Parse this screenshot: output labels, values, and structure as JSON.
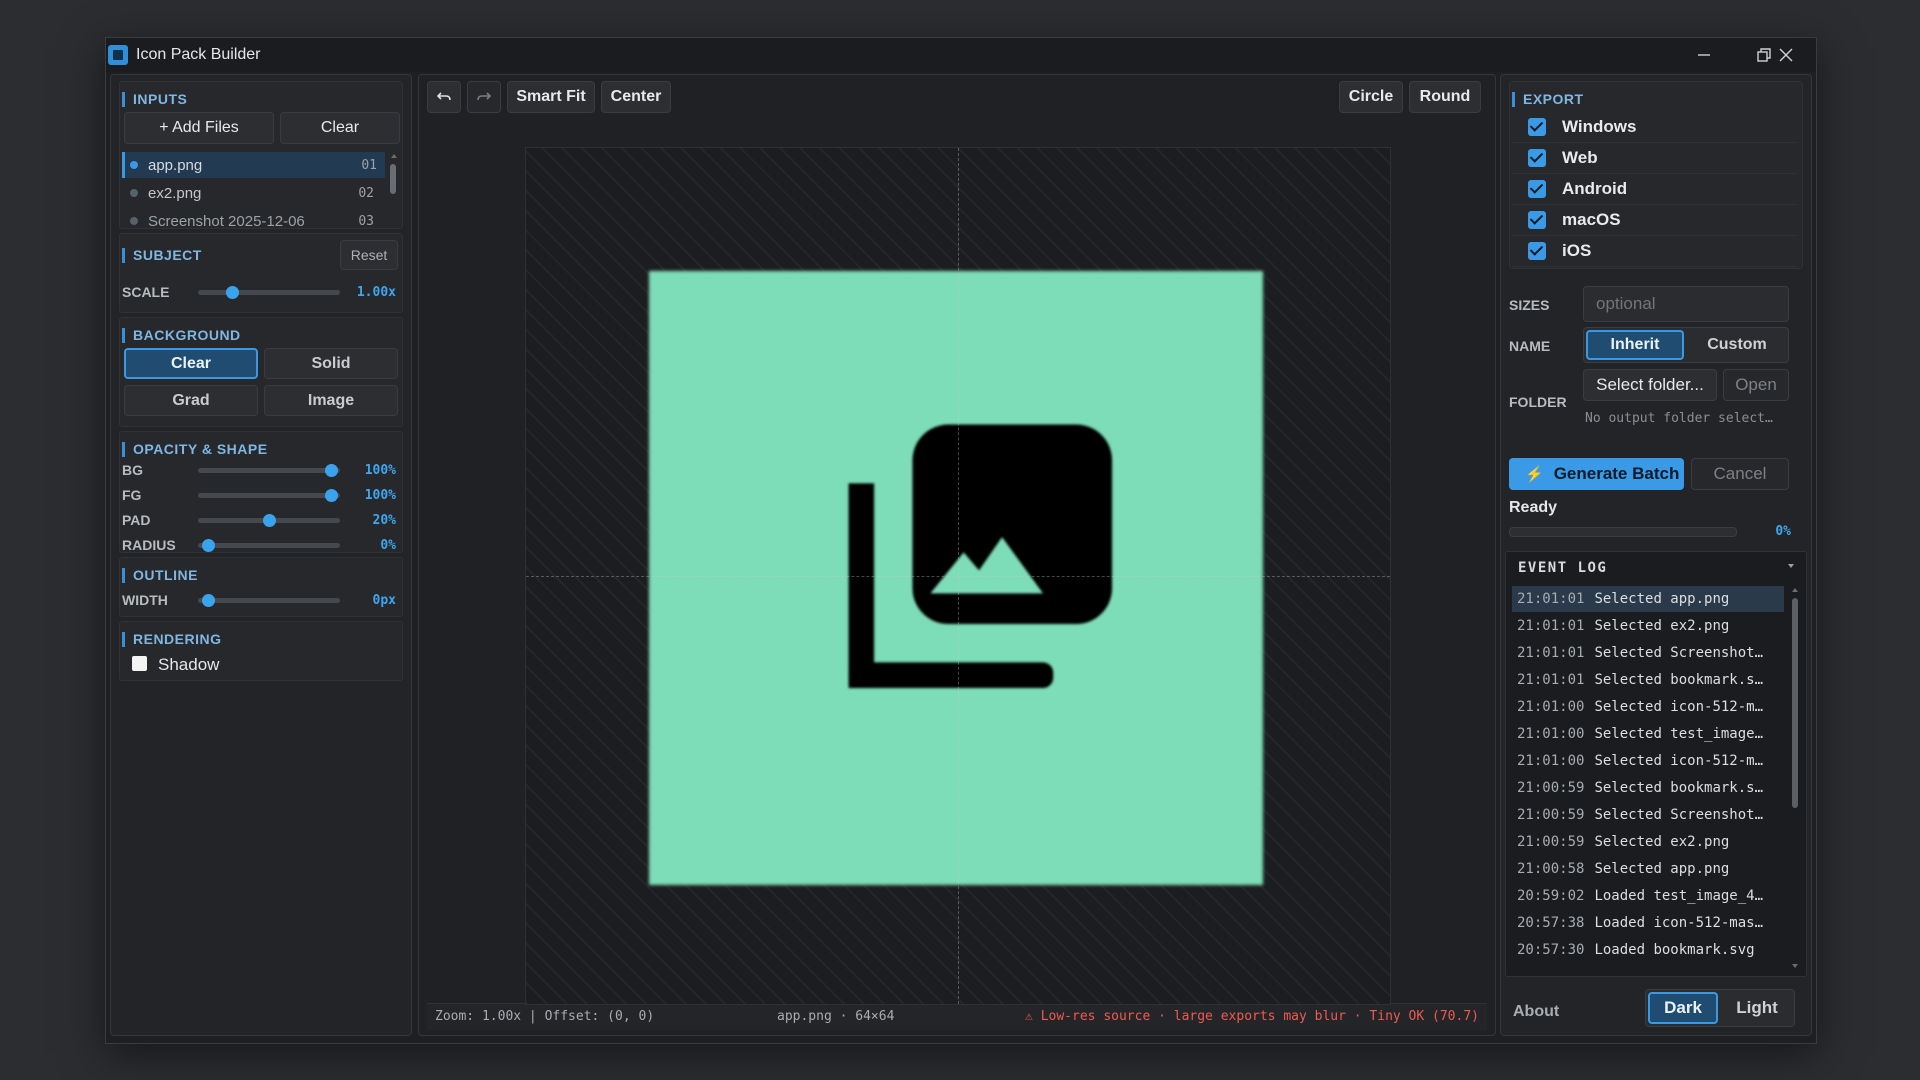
{
  "window": {
    "title": "Icon Pack Builder"
  },
  "inputs": {
    "title": "INPUTS",
    "add_label": "+ Add Files",
    "clear_label": "Clear",
    "files": [
      {
        "name": "app.png",
        "num": "01"
      },
      {
        "name": "ex2.png",
        "num": "02"
      },
      {
        "name": "Screenshot 2025-12-06",
        "num": "03"
      }
    ]
  },
  "subject": {
    "title": "SUBJECT",
    "reset_label": "Reset",
    "scale_label": "SCALE",
    "scale_value": "1.00x",
    "scale_fraction": 0.24
  },
  "background": {
    "title": "BACKGROUND",
    "options": [
      "Clear",
      "Solid",
      "Grad",
      "Image"
    ],
    "selected": "Clear"
  },
  "opacity": {
    "title": "OPACITY & SHAPE",
    "rows": [
      {
        "label": "BG",
        "value": "100%",
        "fraction": 0.94
      },
      {
        "label": "FG",
        "value": "100%",
        "fraction": 0.94
      },
      {
        "label": "PAD",
        "value": "20%",
        "fraction": 0.5
      },
      {
        "label": "RADIUS",
        "value": "0%",
        "fraction": 0.07
      }
    ]
  },
  "outline": {
    "title": "OUTLINE",
    "width_label": "WIDTH",
    "width_value": "0px",
    "fraction": 0.07
  },
  "rendering": {
    "title": "RENDERING",
    "shadow_label": "Shadow",
    "shadow_checked": false
  },
  "toolbar": {
    "undo_icon": "undo-icon",
    "redo_icon": "redo-icon",
    "smart_fit": "Smart Fit",
    "center": "Center",
    "circle": "Circle",
    "round": "Round"
  },
  "preview": {
    "bg_color": "#7dddb8",
    "glyph_color": "#000000"
  },
  "status": {
    "zoom_offset": "Zoom: 1.00x | Offset: (0, 0)",
    "file_info": "app.png · 64×64",
    "warning": "⚠ Low-res source · large exports may blur · Tiny OK (70.7)"
  },
  "export": {
    "title": "EXPORT",
    "targets": [
      {
        "label": "Windows",
        "checked": true
      },
      {
        "label": "Web",
        "checked": true
      },
      {
        "label": "Android",
        "checked": true
      },
      {
        "label": "macOS",
        "checked": true
      },
      {
        "label": "iOS",
        "checked": true
      }
    ],
    "sizes_label": "SIZES",
    "sizes_placeholder": "optional",
    "name_label": "NAME",
    "name_options": [
      "Inherit",
      "Custom"
    ],
    "name_selected": "Inherit",
    "folder_label": "FOLDER",
    "select_folder": "Select folder...",
    "open_label": "Open",
    "folder_status": "No output folder select…",
    "generate_label": "Generate Batch",
    "cancel_label": "Cancel",
    "status": "Ready",
    "progress": "0%",
    "progress_fraction": 0
  },
  "log": {
    "title": "EVENT LOG",
    "entries": [
      {
        "time": "21:01:01",
        "msg": "Selected app.png"
      },
      {
        "time": "21:01:01",
        "msg": "Selected ex2.png"
      },
      {
        "time": "21:01:01",
        "msg": "Selected Screenshot…"
      },
      {
        "time": "21:01:01",
        "msg": "Selected bookmark.s…"
      },
      {
        "time": "21:01:00",
        "msg": "Selected icon-512-m…"
      },
      {
        "time": "21:01:00",
        "msg": "Selected test_image…"
      },
      {
        "time": "21:01:00",
        "msg": "Selected icon-512-m…"
      },
      {
        "time": "21:00:59",
        "msg": "Selected bookmark.s…"
      },
      {
        "time": "21:00:59",
        "msg": "Selected Screenshot…"
      },
      {
        "time": "21:00:59",
        "msg": "Selected ex2.png"
      },
      {
        "time": "21:00:58",
        "msg": "Selected app.png"
      },
      {
        "time": "20:59:02",
        "msg": "Loaded test_image_4…"
      },
      {
        "time": "20:57:38",
        "msg": "Loaded icon-512-mas…"
      },
      {
        "time": "20:57:30",
        "msg": "Loaded bookmark.svg"
      }
    ]
  },
  "footer": {
    "about": "About",
    "themes": [
      "Dark",
      "Light"
    ],
    "theme_selected": "Dark"
  }
}
